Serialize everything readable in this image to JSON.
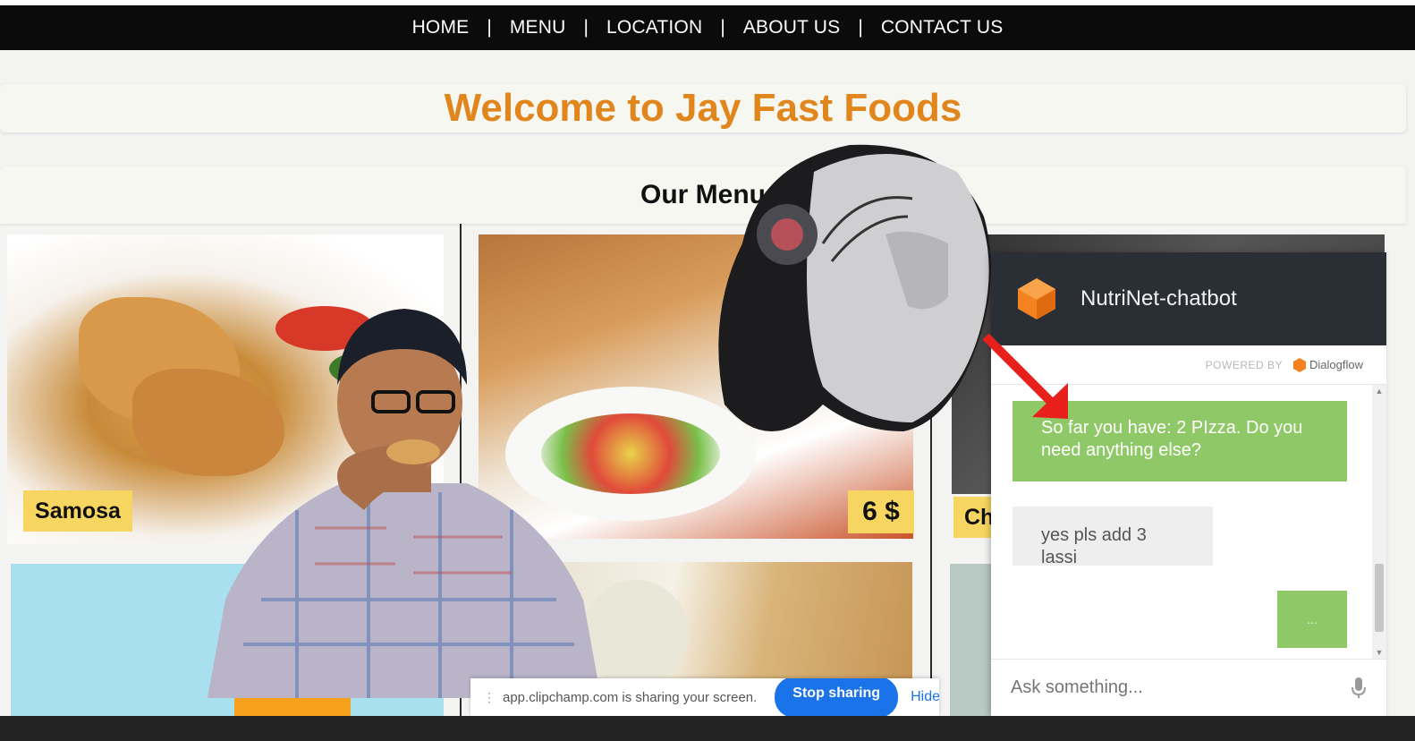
{
  "nav": {
    "items": [
      "HOME",
      "MENU",
      "LOCATION",
      "ABOUT US",
      "CONTACT US"
    ],
    "separator": "|"
  },
  "welcome": {
    "title": "Welcome to Jay Fast Foods"
  },
  "menu": {
    "title": "Our Menu",
    "items": [
      {
        "name": "Samosa"
      },
      {
        "price": "6 $"
      },
      {
        "name": "Ch"
      }
    ]
  },
  "chatbot": {
    "title": "NutriNet-chatbot",
    "powered_by": "POWERED BY",
    "provider": "Dialogflow",
    "messages": [
      {
        "from": "bot",
        "text": "So far you have: 2 PIzza. Do you need anything else?"
      },
      {
        "from": "user",
        "text": "yes pls add 3 lassi"
      },
      {
        "from": "bot",
        "text": "..."
      }
    ],
    "input_placeholder": "Ask something...",
    "icons": {
      "mic": "microphone-icon",
      "logo": "dialogflow-cube-icon"
    }
  },
  "share_bar": {
    "text": "app.clipchamp.com is sharing your screen.",
    "stop_label": "Stop sharing",
    "hide_label": "Hide"
  },
  "colors": {
    "accent_orange": "#e0861c",
    "tag_yellow": "#f6d660",
    "bot_green": "#8fc866",
    "chat_header": "#2a2f35",
    "share_blue": "#1a73e8"
  }
}
